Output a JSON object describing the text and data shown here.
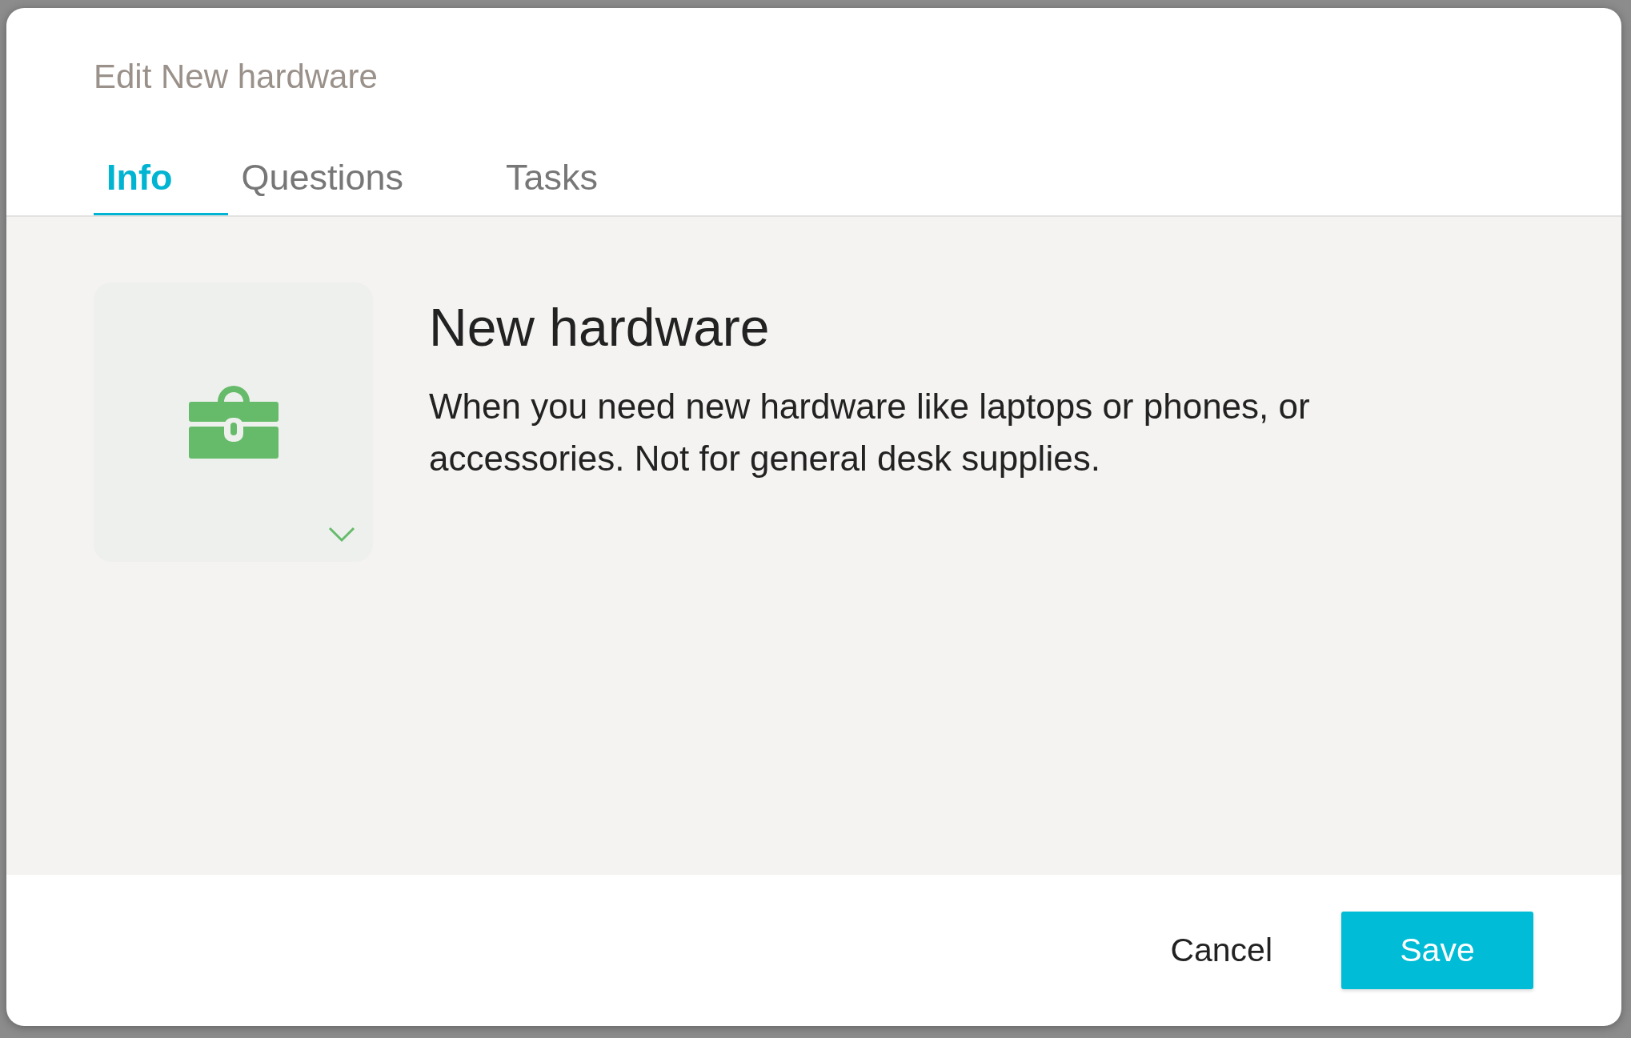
{
  "dialog": {
    "title": "Edit New hardware",
    "tabs": [
      {
        "label": "Info",
        "selected": true
      },
      {
        "label": "Questions",
        "selected": false
      },
      {
        "label": "Tasks",
        "selected": false
      }
    ],
    "item": {
      "name": "New hardware",
      "description": "When you need new hardware like laptops or phones, or accessories. Not for general desk supplies."
    },
    "buttons": [
      {
        "label": "Cancel",
        "kind": "secondary"
      },
      {
        "label": "Save",
        "kind": "primary"
      }
    ]
  }
}
